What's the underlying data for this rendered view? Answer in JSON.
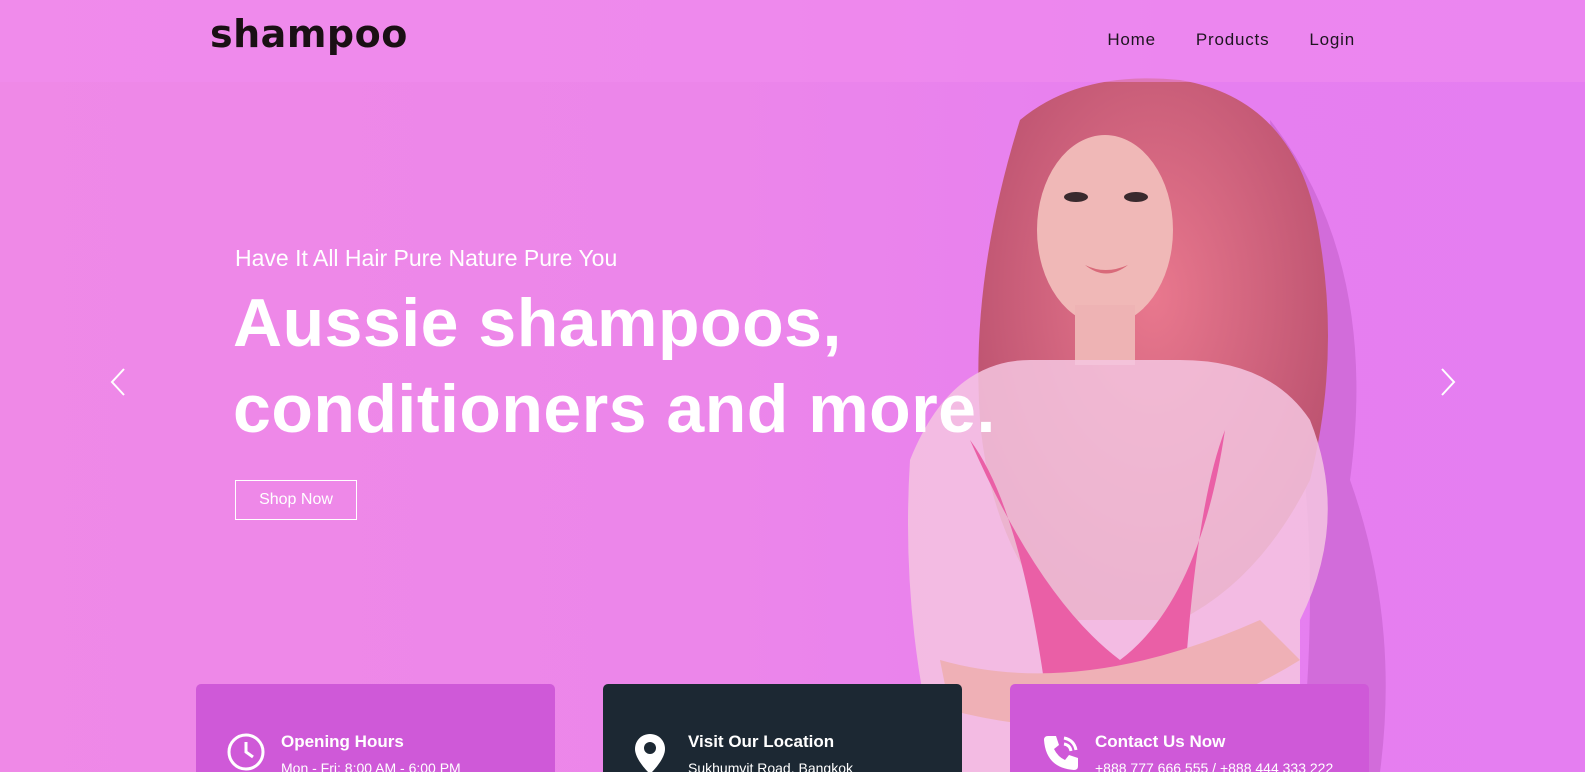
{
  "header": {
    "logo": "shampoo",
    "nav": [
      "Home",
      "Products",
      "Login"
    ]
  },
  "hero": {
    "subtitle": "Have It All Hair Pure Nature Pure You",
    "title_line1": "Aussie shampoos,",
    "title_line2": "conditioners and more.",
    "cta": "Shop Now"
  },
  "cards": [
    {
      "icon": "clock-icon",
      "title": "Opening Hours",
      "line": "Mon - Fri: 8:00 AM - 6:00 PM"
    },
    {
      "icon": "location-pin-icon",
      "title": "Visit Our Location",
      "line": "Sukhumvit Road, Bangkok"
    },
    {
      "icon": "phone-icon",
      "title": "Contact Us Now",
      "line": "+888 777 666 555 / +888 444 333 222"
    }
  ],
  "colors": {
    "hero_bg": "#ec86ea",
    "card_accent": "#cf59d8",
    "card_dark": "#1c2833"
  }
}
